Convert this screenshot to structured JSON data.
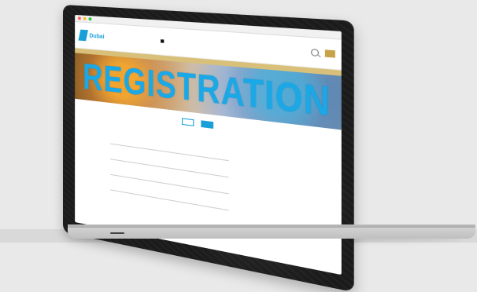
{
  "site": {
    "brand_name": "Dubai",
    "brand_sub": "",
    "nav": [
      "",
      "",
      "",
      "",
      "",
      ""
    ],
    "nav_active_index": 4,
    "cta_label": "",
    "subbar_text": ""
  },
  "hero": {
    "title": "REGISTRATION"
  },
  "tabs": [
    {
      "label": "",
      "selected": false
    },
    {
      "label": "",
      "selected": true
    }
  ],
  "form": {
    "intro_text": "",
    "field_title": "",
    "radio_options": [
      "",
      ""
    ],
    "labels": [
      "",
      "",
      "",
      ""
    ]
  },
  "colors": {
    "accent": "#19a0d8",
    "gold": "#c7a44a"
  }
}
